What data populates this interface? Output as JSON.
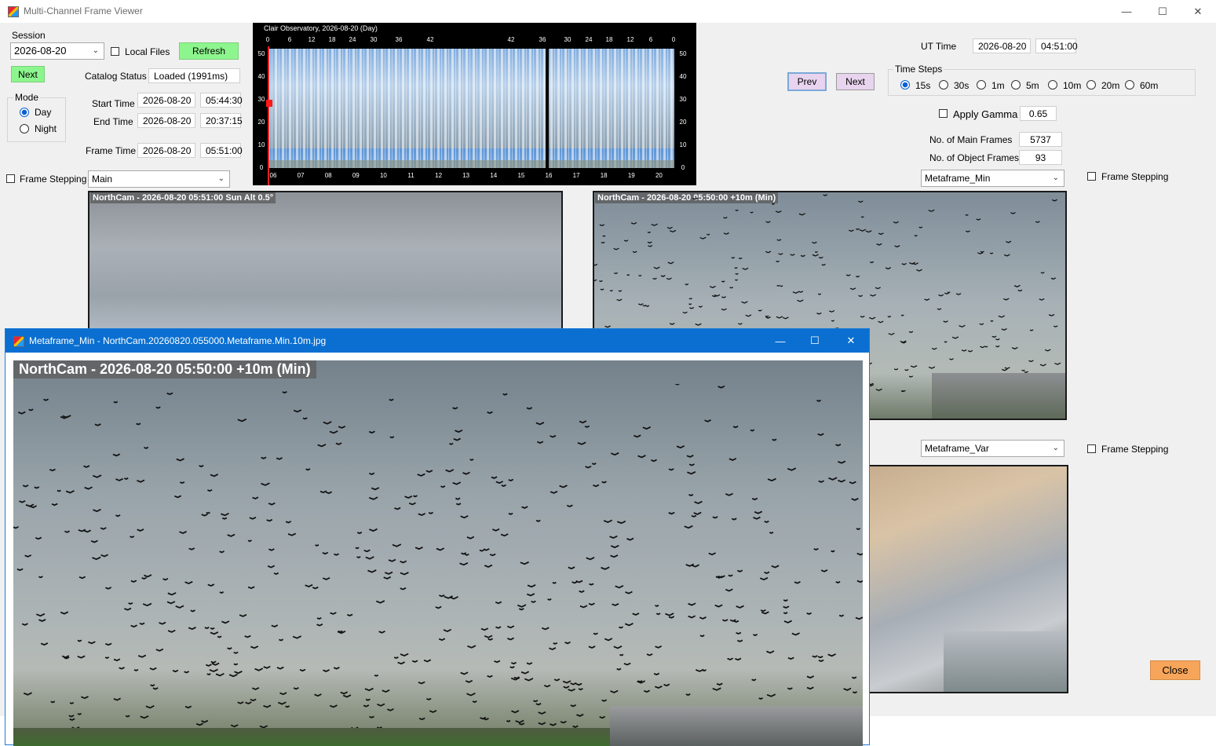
{
  "window": {
    "title": "Multi-Channel Frame Viewer",
    "icon": "app-icon"
  },
  "session": {
    "label": "Session",
    "value": "2026-08-20",
    "local_files": "Local Files",
    "refresh": "Refresh",
    "next": "Next"
  },
  "catalog": {
    "label": "Catalog Status",
    "value": "Loaded (1991ms)"
  },
  "mode": {
    "label": "Mode",
    "day": "Day",
    "night": "Night",
    "selected": "Day"
  },
  "times": {
    "start_label": "Start Time",
    "start_date": "2026-08-20",
    "start_time": "05:44:30",
    "end_label": "End Time",
    "end_date": "2026-08-20",
    "end_time": "20:37:15",
    "frame_label": "Frame Time",
    "frame_date": "2026-08-20",
    "frame_time": "05:51:00"
  },
  "left_channel": {
    "frame_stepping": "Frame Stepping",
    "selected": "Main"
  },
  "keogram": {
    "title": "Clair Observatory, 2026-08-20 (Day)",
    "top_ticks": [
      "0",
      "6",
      "12",
      "18",
      "24",
      "30",
      "36",
      "42",
      "42",
      "36",
      "30",
      "24",
      "18",
      "12",
      "6",
      "0"
    ],
    "y_ticks": [
      "50",
      "40",
      "30",
      "20",
      "10",
      "0"
    ],
    "x_ticks": [
      "06",
      "07",
      "08",
      "09",
      "10",
      "11",
      "12",
      "13",
      "14",
      "15",
      "16",
      "17",
      "18",
      "19",
      "20"
    ]
  },
  "ut": {
    "label": "UT Time",
    "date": "2026-08-20",
    "time": "04:51:00"
  },
  "nav": {
    "prev": "Prev",
    "next": "Next"
  },
  "time_steps": {
    "label": "Time Steps",
    "options": [
      "15s",
      "30s",
      "1m",
      "5m",
      "10m",
      "20m",
      "60m"
    ],
    "selected": "15s"
  },
  "gamma": {
    "label": "Apply Gamma",
    "value": "0.65"
  },
  "counts": {
    "main_label": "No. of Main Frames",
    "main_value": "5737",
    "object_label": "No. of Object Frames",
    "object_value": "93"
  },
  "right_channel_1": {
    "selected": "Metaframe_Min",
    "frame_stepping": "Frame Stepping"
  },
  "right_channel_2": {
    "selected": "Metaframe_Var",
    "frame_stepping": "Frame Stepping"
  },
  "frames": {
    "main_caption": "NorthCam - 2026-08-20 05:51:00  Sun Alt 0.5°",
    "min_caption": "NorthCam - 2026-08-20 05:50:00 +10m  (Min)"
  },
  "close": "Close",
  "popup": {
    "title": "Metaframe_Min - NorthCam.20260820.055000.Metaframe.Min.10m.jpg",
    "caption": "NorthCam - 2026-08-20 05:50:00 +10m  (Min)"
  },
  "colors": {
    "green_button": "#8df58d",
    "pink_button": "#e8d4ee",
    "close_button": "#f7a55a",
    "popup_titlebar": "#0a6fd1"
  }
}
